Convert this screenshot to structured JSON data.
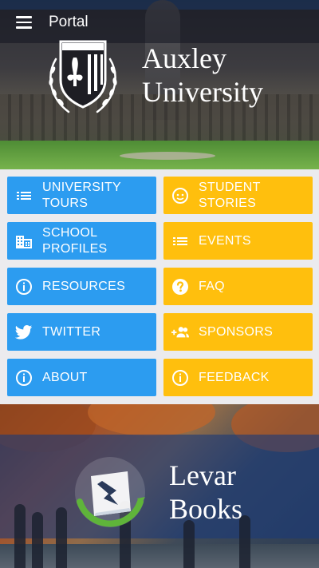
{
  "header": {
    "title": "Portal",
    "menu_icon": "hamburger-menu-icon",
    "university_name_line1": "Auxley",
    "university_name_line2": "University",
    "crest_icon": "university-crest-icon"
  },
  "grid": {
    "colors": {
      "left": "#2c9cf0",
      "right": "#ffbf0d"
    },
    "tiles": [
      {
        "label_line1": "UNIVERSITY",
        "label_line2": "TOURS",
        "icon": "list-icon"
      },
      {
        "label_line1": "STUDENT",
        "label_line2": "STORIES",
        "icon": "smiley-face-icon"
      },
      {
        "label_line1": "SCHOOL",
        "label_line2": "PROFILES",
        "icon": "building-icon"
      },
      {
        "label_line1": "EVENTS",
        "label_line2": "",
        "icon": "list-icon"
      },
      {
        "label_line1": "RESOURCES",
        "label_line2": "",
        "icon": "info-icon"
      },
      {
        "label_line1": "FAQ",
        "label_line2": "",
        "icon": "help-icon"
      },
      {
        "label_line1": "TWITTER",
        "label_line2": "",
        "icon": "twitter-bird-icon"
      },
      {
        "label_line1": "SPONSORS",
        "label_line2": "",
        "icon": "people-add-icon"
      },
      {
        "label_line1": "ABOUT",
        "label_line2": "",
        "icon": "info-icon"
      },
      {
        "label_line1": "FEEDBACK",
        "label_line2": "",
        "icon": "info-icon"
      }
    ]
  },
  "promo": {
    "name_line1": "Levar",
    "name_line2": "Books",
    "logo_icon": "books-logo-icon"
  }
}
